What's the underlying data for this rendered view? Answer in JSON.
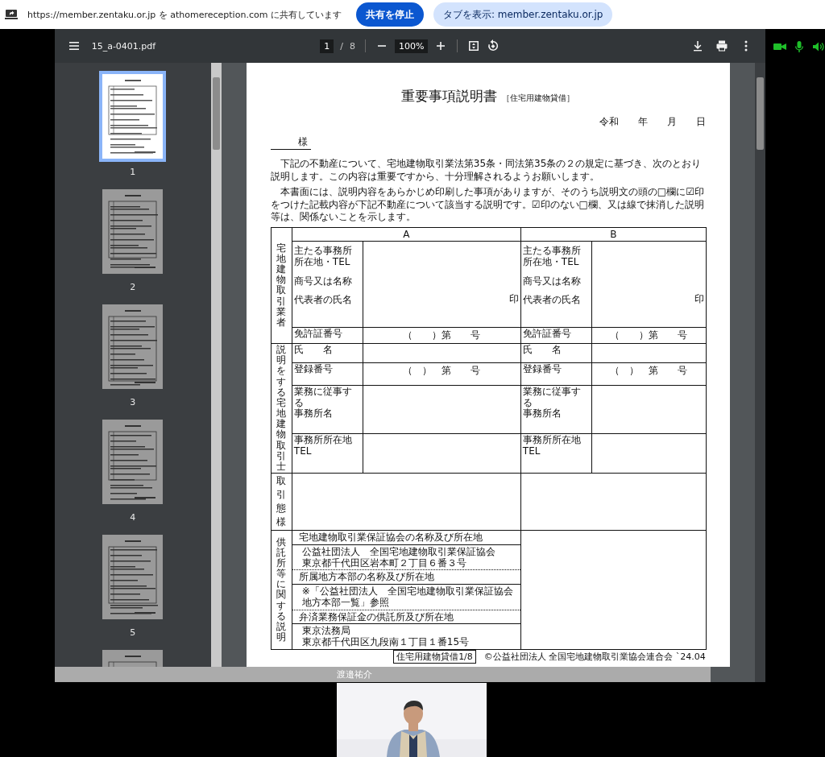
{
  "share_bar": {
    "message": "https://member.zentaku.or.jp を athomereception.com に共有しています",
    "buttons": [
      {
        "label": "共有を停止",
        "kind": "primary"
      },
      {
        "label": "タブを表示: member.zentaku.or.jp",
        "kind": "secondary"
      }
    ]
  },
  "pdf_viewer": {
    "file_name": "15_a-0401.pdf",
    "page_input": "1",
    "page_separator": "/",
    "page_count": "8",
    "zoom": "100%",
    "thumbnails": [
      {
        "label": "1",
        "selected": true
      },
      {
        "label": "2",
        "selected": false
      },
      {
        "label": "3",
        "selected": false
      },
      {
        "label": "4",
        "selected": false
      },
      {
        "label": "5",
        "selected": false
      },
      {
        "selected": false
      }
    ]
  },
  "document": {
    "title": "重要事項説明書",
    "subtitle": "［住宅用建物貸借］",
    "date": [
      "令和",
      "年",
      "月",
      "日"
    ],
    "addressee": "様",
    "paragraphs": [
      "下記の不動産について、宅地建物取引業法第35条・同法第35条の２の規定に基づき、次のとおり説明します。この内容は重要ですから、十分理解されるようお願いします。",
      "本書面には、説明内容をあらかじめ印刷した事項がありますが、そのうち説明文の頭の□欄に☑印をつけた記載内容が下記不動産について該当する説明です。☑印のない□欄、又は線で抹消した説明等は、関係ないことを示します。"
    ],
    "broker_section": {
      "heading": "宅地建物取引業者",
      "columns": [
        {
          "header": "A",
          "fields": [
            [
              "主たる事務所",
              "所在地・TEL"
            ],
            [
              "商号又は名称"
            ],
            [
              "代表者の氏名"
            ]
          ],
          "seal": "印",
          "license_label": "免許証番号",
          "license_value": "（　　）第　　号"
        },
        {
          "header": "B",
          "fields": [
            [
              "主たる事務所",
              "所在地・TEL"
            ],
            [
              "商号又は名称"
            ],
            [
              "代表者の氏名"
            ]
          ],
          "seal": "印",
          "license_label": "免許証番号",
          "license_value": "（　　）第　　号"
        }
      ]
    },
    "agent_section": {
      "heading": "説明をする宅地建物取引士",
      "columns": [
        {
          "rows": [
            {
              "label": [
                "氏　　名"
              ]
            },
            {
              "label": [
                "登録番号"
              ],
              "value": "（　）　第　　号"
            },
            {
              "label": [
                "業務に従事する",
                "事務所名"
              ]
            },
            {
              "label": [
                "事務所所在地",
                "TEL"
              ]
            }
          ]
        },
        {
          "rows": [
            {
              "label": [
                "氏　　名"
              ]
            },
            {
              "label": [
                "登録番号"
              ],
              "value": "（　）　第　　号"
            },
            {
              "label": [
                "業務に従事する",
                "事務所名"
              ]
            },
            {
              "label": [
                "事務所所在地",
                "TEL"
              ]
            }
          ]
        }
      ]
    },
    "transaction_section": {
      "heading": [
        "取引",
        "態様"
      ]
    },
    "deposit_section": {
      "heading": "供託所等に関する説明",
      "items": [
        {
          "kind": "heading",
          "lines": [
            "宅地建物取引業保証協会の名称及び所在地"
          ]
        },
        {
          "kind": "detail",
          "lines": [
            "公益社団法人　全国宅地建物取引業保証協会",
            "東京都千代田区岩本町２丁目６番３号"
          ]
        },
        {
          "kind": "heading",
          "lines": [
            "所属地方本部の名称及び所在地"
          ]
        },
        {
          "kind": "detail",
          "lines": [
            "※「公益社団法人　全国宅地建物取引業保証協会",
            "地方本部一覧」参照"
          ]
        },
        {
          "kind": "heading",
          "lines": [
            "弁済業務保証金の供託所及び所在地"
          ]
        },
        {
          "kind": "detail",
          "lines": [
            "東京法務局",
            "東京都千代田区九段南１丁目１番15号"
          ]
        }
      ]
    },
    "footer": {
      "form_tag": "住宅用建物貸借1/8",
      "copyright": "©公益社団法人 全国宅地建物取引業協会連合会 `24.04"
    }
  },
  "participant_name": "渡邉祐介"
}
